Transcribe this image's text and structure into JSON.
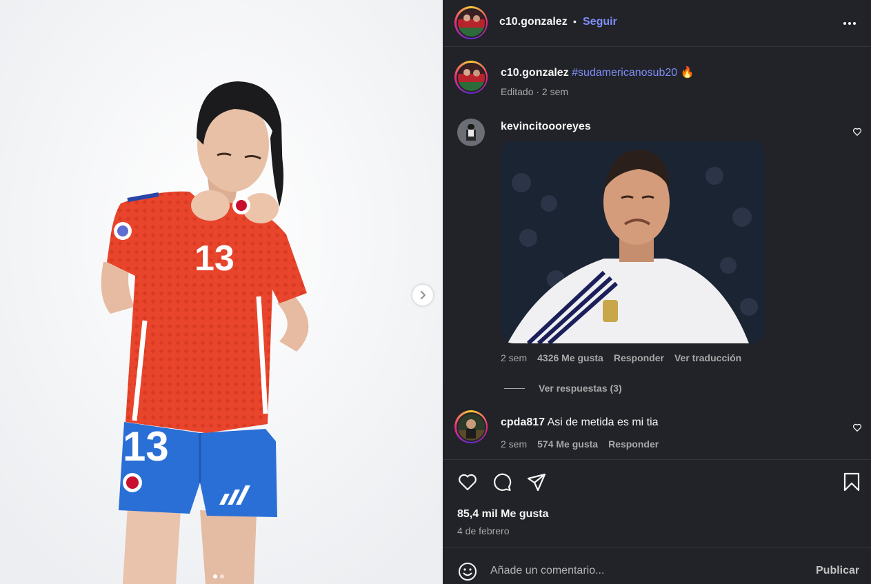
{
  "post": {
    "author": "c10.gonzalez",
    "separator": "•",
    "follow_label": "Seguir",
    "more_icon": "more-horizontal-icon"
  },
  "media": {
    "description_icon": "player-photo",
    "jersey_number": "13",
    "next_icon": "chevron-right-icon",
    "slide_count": 2,
    "active_slide": 1
  },
  "caption": {
    "user": "c10.gonzalez",
    "hashtag": "#sudamericanosub20",
    "emoji": "🔥",
    "meta": "Editado · 2 sem"
  },
  "comments": [
    {
      "user": "kevincitoooreyes",
      "has_gif": true,
      "time": "2 sem",
      "likes": "4326 Me gusta",
      "reply": "Responder",
      "translate": "Ver traducción",
      "view_replies": "Ver respuestas (3)"
    },
    {
      "user": "cpda817",
      "text": "Asi de metida es mi tia",
      "time": "2 sem",
      "likes": "574 Me gusta",
      "reply": "Responder"
    }
  ],
  "actions": {
    "like_icon": "heart-icon",
    "comment_icon": "comment-icon",
    "share_icon": "send-icon",
    "save_icon": "bookmark-icon"
  },
  "stats": {
    "likes": "85,4 mil Me gusta",
    "date": "4 de febrero"
  },
  "composer": {
    "emoji_icon": "smiley-icon",
    "placeholder": "Añade un comentario...",
    "value": "",
    "publish_label": "Publicar"
  },
  "colors": {
    "panel_bg": "#212328",
    "link_accent": "#7f8ef7",
    "secondary_text": "#a8a8a8",
    "jersey_red": "#e8452c",
    "shorts_blue": "#2a6fd6"
  }
}
